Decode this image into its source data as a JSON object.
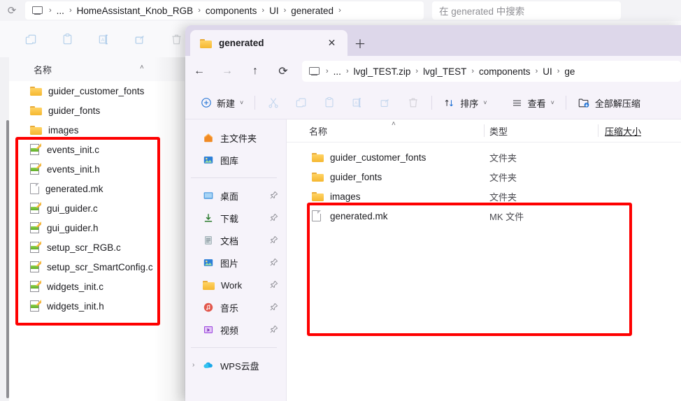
{
  "background_window": {
    "address_bar": {
      "refresh_icon": "refresh-icon",
      "pc_icon": "this-pc-icon",
      "overflow": "...",
      "breadcrumbs": [
        "HomeAssistant_Knob_RGB",
        "components",
        "UI",
        "generated"
      ],
      "separator": "›",
      "search_placeholder": "在 generated 中搜索"
    },
    "toolbar_icons": [
      "copy-icon",
      "paste-icon",
      "rename-icon",
      "share-icon",
      "delete-icon"
    ],
    "column_header": "名称",
    "sort_caret": "˄",
    "files": [
      {
        "name": "guider_customer_fonts",
        "icon": "folder-icon"
      },
      {
        "name": "guider_fonts",
        "icon": "folder-icon"
      },
      {
        "name": "images",
        "icon": "folder-icon"
      },
      {
        "name": "events_init.c",
        "icon": "code-file-icon"
      },
      {
        "name": "events_init.h",
        "icon": "code-file-icon"
      },
      {
        "name": "generated.mk",
        "icon": "generic-file-icon"
      },
      {
        "name": "gui_guider.c",
        "icon": "code-file-icon"
      },
      {
        "name": "gui_guider.h",
        "icon": "code-file-icon"
      },
      {
        "name": "setup_scr_RGB.c",
        "icon": "code-file-icon"
      },
      {
        "name": "setup_scr_SmartConfig.c",
        "icon": "code-file-icon"
      },
      {
        "name": "widgets_init.c",
        "icon": "code-file-icon"
      },
      {
        "name": "widgets_init.h",
        "icon": "code-file-icon"
      }
    ]
  },
  "foreground_window": {
    "tab": {
      "title": "generated",
      "folder_icon": "folder-icon",
      "close": "✕",
      "new_tab": "＋"
    },
    "nav_buttons": {
      "back": "←",
      "forward": "→",
      "up": "↑",
      "refresh": "⟳"
    },
    "address_bar": {
      "pc_icon": "this-pc-icon",
      "overflow": "...",
      "breadcrumbs": [
        "lvgl_TEST.zip",
        "lvgl_TEST",
        "components",
        "UI",
        "ge"
      ],
      "separator": "›"
    },
    "toolbar": {
      "new_label": "新建",
      "new_icon": "plus-circle-icon",
      "caret": "˅",
      "icons": [
        "cut-icon",
        "copy-icon",
        "paste-icon",
        "rename-icon",
        "share-icon",
        "delete-icon"
      ],
      "sort_label": "排序",
      "sort_icon": "sort-arrows-icon",
      "view_label": "查看",
      "view_icon": "list-lines-icon",
      "extract_all_label": "全部解压缩",
      "extract_all_icon": "extract-folder-icon"
    },
    "nav_pane": {
      "top_items": [
        {
          "label": "主文件夹",
          "icon": "home-icon",
          "pinned": false
        },
        {
          "label": "图库",
          "icon": "gallery-icon",
          "pinned": false
        }
      ],
      "quick_items": [
        {
          "label": "桌面",
          "icon": "desktop-icon",
          "pinned": true
        },
        {
          "label": "下载",
          "icon": "downloads-icon",
          "pinned": true
        },
        {
          "label": "文档",
          "icon": "documents-icon",
          "pinned": true
        },
        {
          "label": "图片",
          "icon": "pictures-icon",
          "pinned": true
        },
        {
          "label": "Work",
          "icon": "folder-icon",
          "pinned": true
        },
        {
          "label": "音乐",
          "icon": "music-icon",
          "pinned": true
        },
        {
          "label": "视频",
          "icon": "videos-icon",
          "pinned": true
        }
      ],
      "drives": [
        {
          "label": "WPS云盘",
          "icon": "cloud-icon",
          "chevron": "›"
        }
      ],
      "pin_icon": "pin-icon"
    },
    "columns": [
      {
        "label": "名称",
        "underlined": false
      },
      {
        "label": "类型",
        "underlined": false
      },
      {
        "label": "压缩大小",
        "underlined": true
      }
    ],
    "sort_caret": "˄",
    "rows": [
      {
        "name": "guider_customer_fonts",
        "type": "文件夹",
        "icon": "folder-icon"
      },
      {
        "name": "guider_fonts",
        "type": "文件夹",
        "icon": "folder-icon"
      },
      {
        "name": "images",
        "type": "文件夹",
        "icon": "folder-icon"
      },
      {
        "name": "generated.mk",
        "type": "MK 文件",
        "icon": "generic-file-icon"
      }
    ]
  },
  "annotations": {
    "left_box": "red-highlight-box",
    "right_box": "red-highlight-box",
    "color": "#fe0000"
  }
}
